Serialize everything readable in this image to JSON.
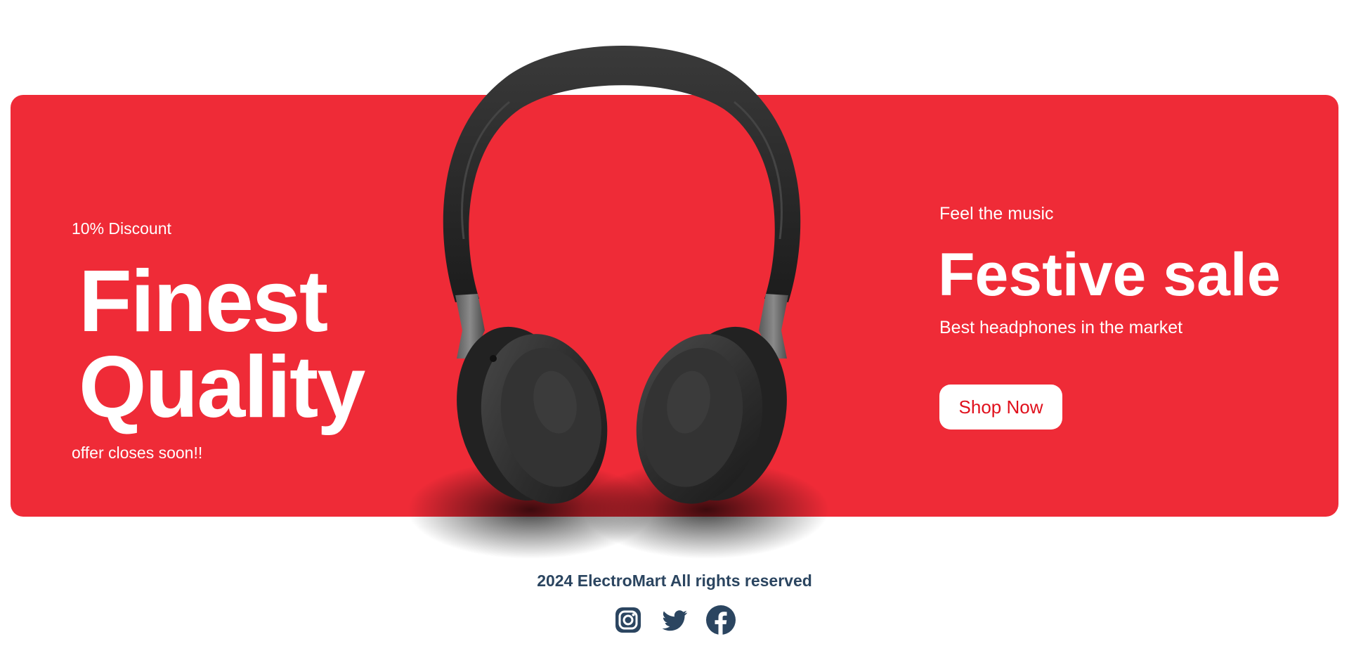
{
  "banner": {
    "left": {
      "discount": "10% Discount",
      "headline_line1": "Finest",
      "headline_line2": "Quality",
      "closing": "offer closes soon!!"
    },
    "right": {
      "tagline": "Feel the music",
      "title": "Festive sale",
      "subtitle": "Best headphones in the market",
      "cta_label": "Shop Now"
    },
    "product_image": "headphones-image",
    "background_color": "#ef2b37",
    "cta_text_color": "#e0101c"
  },
  "footer": {
    "copyright": "2024 ElectroMart All rights reserved",
    "social_icons": [
      "instagram-icon",
      "twitter-icon",
      "facebook-icon"
    ],
    "icon_color": "#2b4560"
  }
}
